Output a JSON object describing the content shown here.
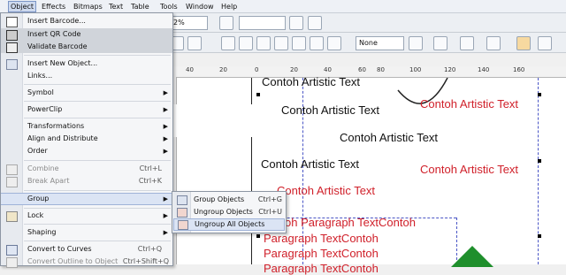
{
  "menubar": [
    "Object",
    "Effects",
    "Bitmaps",
    "Text",
    "Table",
    "Tools",
    "Window",
    "Help"
  ],
  "toolbar": {
    "zoom_fragment": "2%",
    "outline_value": "None"
  },
  "ruler_ticks": [
    "40",
    "20",
    "0",
    "20",
    "40",
    "60",
    "80",
    "100",
    "120",
    "140",
    "160"
  ],
  "menu": {
    "items": [
      {
        "label": "Insert Barcode...",
        "shortcut": "",
        "arrow": false,
        "icon": "barcode-icon"
      },
      {
        "label": "Insert QR Code",
        "shortcut": "",
        "arrow": false,
        "icon": "qr-code-icon"
      },
      {
        "label": "Validate Barcode",
        "shortcut": "",
        "arrow": false,
        "icon": "validate-barcode-icon"
      },
      {
        "label": "Insert New Object...",
        "shortcut": "",
        "arrow": false,
        "icon": "insert-object-icon"
      },
      {
        "label": "Links...",
        "shortcut": "",
        "arrow": false,
        "icon": ""
      },
      {
        "label": "Symbol",
        "shortcut": "",
        "arrow": true,
        "icon": ""
      },
      {
        "label": "PowerClip",
        "shortcut": "",
        "arrow": true,
        "icon": ""
      },
      {
        "label": "Transformations",
        "shortcut": "",
        "arrow": true,
        "icon": ""
      },
      {
        "label": "Align and Distribute",
        "shortcut": "",
        "arrow": true,
        "icon": ""
      },
      {
        "label": "Order",
        "shortcut": "",
        "arrow": true,
        "icon": ""
      },
      {
        "label": "Combine",
        "shortcut": "Ctrl+L",
        "arrow": false,
        "icon": "combine-icon"
      },
      {
        "label": "Break Apart",
        "shortcut": "Ctrl+K",
        "arrow": false,
        "icon": "break-apart-icon"
      },
      {
        "label": "Group",
        "shortcut": "",
        "arrow": true,
        "icon": ""
      },
      {
        "label": "Lock",
        "shortcut": "",
        "arrow": true,
        "icon": "lock-icon"
      },
      {
        "label": "Shaping",
        "shortcut": "",
        "arrow": true,
        "icon": ""
      },
      {
        "label": "Convert to Curves",
        "shortcut": "Ctrl+Q",
        "arrow": false,
        "icon": "curves-icon"
      },
      {
        "label": "Convert Outline to Object",
        "shortcut": "Ctrl+Shift+Q",
        "arrow": false,
        "icon": "outline-object-icon"
      }
    ]
  },
  "submenu": {
    "items": [
      {
        "label": "Group Objects",
        "shortcut": "Ctrl+G"
      },
      {
        "label": "Ungroup Objects",
        "shortcut": "Ctrl+U"
      },
      {
        "label": "Ungroup All Objects",
        "shortcut": ""
      }
    ]
  },
  "canvas": {
    "artistic": [
      "Contoh Artistic Text",
      "Contoh Artistic Text",
      "Contoh Artistic Text",
      "Contoh Artistic Text",
      "Contoh Artistic Text",
      "Contoh Artistic Text",
      "Contoh Artistic Text"
    ],
    "paragraph": [
      "oh Paragraph TextContoh",
      "Paragraph TextContoh",
      "Paragraph TextContoh",
      "Paragraph TextContoh"
    ]
  },
  "colors": {
    "red_text": "#d0202a",
    "selection_dash": "#4a56c6",
    "star": "#1f8f2c"
  }
}
